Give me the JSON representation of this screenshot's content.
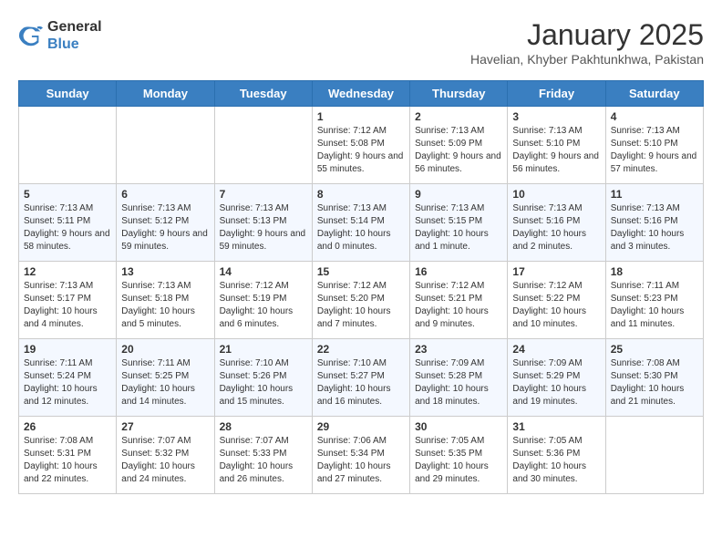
{
  "header": {
    "logo_general": "General",
    "logo_blue": "Blue",
    "month": "January 2025",
    "location": "Havelian, Khyber Pakhtunkhwa, Pakistan"
  },
  "days_of_week": [
    "Sunday",
    "Monday",
    "Tuesday",
    "Wednesday",
    "Thursday",
    "Friday",
    "Saturday"
  ],
  "weeks": [
    [
      {
        "date": "",
        "info": ""
      },
      {
        "date": "",
        "info": ""
      },
      {
        "date": "",
        "info": ""
      },
      {
        "date": "1",
        "info": "Sunrise: 7:12 AM\nSunset: 5:08 PM\nDaylight: 9 hours and 55 minutes."
      },
      {
        "date": "2",
        "info": "Sunrise: 7:13 AM\nSunset: 5:09 PM\nDaylight: 9 hours and 56 minutes."
      },
      {
        "date": "3",
        "info": "Sunrise: 7:13 AM\nSunset: 5:10 PM\nDaylight: 9 hours and 56 minutes."
      },
      {
        "date": "4",
        "info": "Sunrise: 7:13 AM\nSunset: 5:10 PM\nDaylight: 9 hours and 57 minutes."
      }
    ],
    [
      {
        "date": "5",
        "info": "Sunrise: 7:13 AM\nSunset: 5:11 PM\nDaylight: 9 hours and 58 minutes."
      },
      {
        "date": "6",
        "info": "Sunrise: 7:13 AM\nSunset: 5:12 PM\nDaylight: 9 hours and 59 minutes."
      },
      {
        "date": "7",
        "info": "Sunrise: 7:13 AM\nSunset: 5:13 PM\nDaylight: 9 hours and 59 minutes."
      },
      {
        "date": "8",
        "info": "Sunrise: 7:13 AM\nSunset: 5:14 PM\nDaylight: 10 hours and 0 minutes."
      },
      {
        "date": "9",
        "info": "Sunrise: 7:13 AM\nSunset: 5:15 PM\nDaylight: 10 hours and 1 minute."
      },
      {
        "date": "10",
        "info": "Sunrise: 7:13 AM\nSunset: 5:16 PM\nDaylight: 10 hours and 2 minutes."
      },
      {
        "date": "11",
        "info": "Sunrise: 7:13 AM\nSunset: 5:16 PM\nDaylight: 10 hours and 3 minutes."
      }
    ],
    [
      {
        "date": "12",
        "info": "Sunrise: 7:13 AM\nSunset: 5:17 PM\nDaylight: 10 hours and 4 minutes."
      },
      {
        "date": "13",
        "info": "Sunrise: 7:13 AM\nSunset: 5:18 PM\nDaylight: 10 hours and 5 minutes."
      },
      {
        "date": "14",
        "info": "Sunrise: 7:12 AM\nSunset: 5:19 PM\nDaylight: 10 hours and 6 minutes."
      },
      {
        "date": "15",
        "info": "Sunrise: 7:12 AM\nSunset: 5:20 PM\nDaylight: 10 hours and 7 minutes."
      },
      {
        "date": "16",
        "info": "Sunrise: 7:12 AM\nSunset: 5:21 PM\nDaylight: 10 hours and 9 minutes."
      },
      {
        "date": "17",
        "info": "Sunrise: 7:12 AM\nSunset: 5:22 PM\nDaylight: 10 hours and 10 minutes."
      },
      {
        "date": "18",
        "info": "Sunrise: 7:11 AM\nSunset: 5:23 PM\nDaylight: 10 hours and 11 minutes."
      }
    ],
    [
      {
        "date": "19",
        "info": "Sunrise: 7:11 AM\nSunset: 5:24 PM\nDaylight: 10 hours and 12 minutes."
      },
      {
        "date": "20",
        "info": "Sunrise: 7:11 AM\nSunset: 5:25 PM\nDaylight: 10 hours and 14 minutes."
      },
      {
        "date": "21",
        "info": "Sunrise: 7:10 AM\nSunset: 5:26 PM\nDaylight: 10 hours and 15 minutes."
      },
      {
        "date": "22",
        "info": "Sunrise: 7:10 AM\nSunset: 5:27 PM\nDaylight: 10 hours and 16 minutes."
      },
      {
        "date": "23",
        "info": "Sunrise: 7:09 AM\nSunset: 5:28 PM\nDaylight: 10 hours and 18 minutes."
      },
      {
        "date": "24",
        "info": "Sunrise: 7:09 AM\nSunset: 5:29 PM\nDaylight: 10 hours and 19 minutes."
      },
      {
        "date": "25",
        "info": "Sunrise: 7:08 AM\nSunset: 5:30 PM\nDaylight: 10 hours and 21 minutes."
      }
    ],
    [
      {
        "date": "26",
        "info": "Sunrise: 7:08 AM\nSunset: 5:31 PM\nDaylight: 10 hours and 22 minutes."
      },
      {
        "date": "27",
        "info": "Sunrise: 7:07 AM\nSunset: 5:32 PM\nDaylight: 10 hours and 24 minutes."
      },
      {
        "date": "28",
        "info": "Sunrise: 7:07 AM\nSunset: 5:33 PM\nDaylight: 10 hours and 26 minutes."
      },
      {
        "date": "29",
        "info": "Sunrise: 7:06 AM\nSunset: 5:34 PM\nDaylight: 10 hours and 27 minutes."
      },
      {
        "date": "30",
        "info": "Sunrise: 7:05 AM\nSunset: 5:35 PM\nDaylight: 10 hours and 29 minutes."
      },
      {
        "date": "31",
        "info": "Sunrise: 7:05 AM\nSunset: 5:36 PM\nDaylight: 10 hours and 30 minutes."
      },
      {
        "date": "",
        "info": ""
      }
    ]
  ]
}
